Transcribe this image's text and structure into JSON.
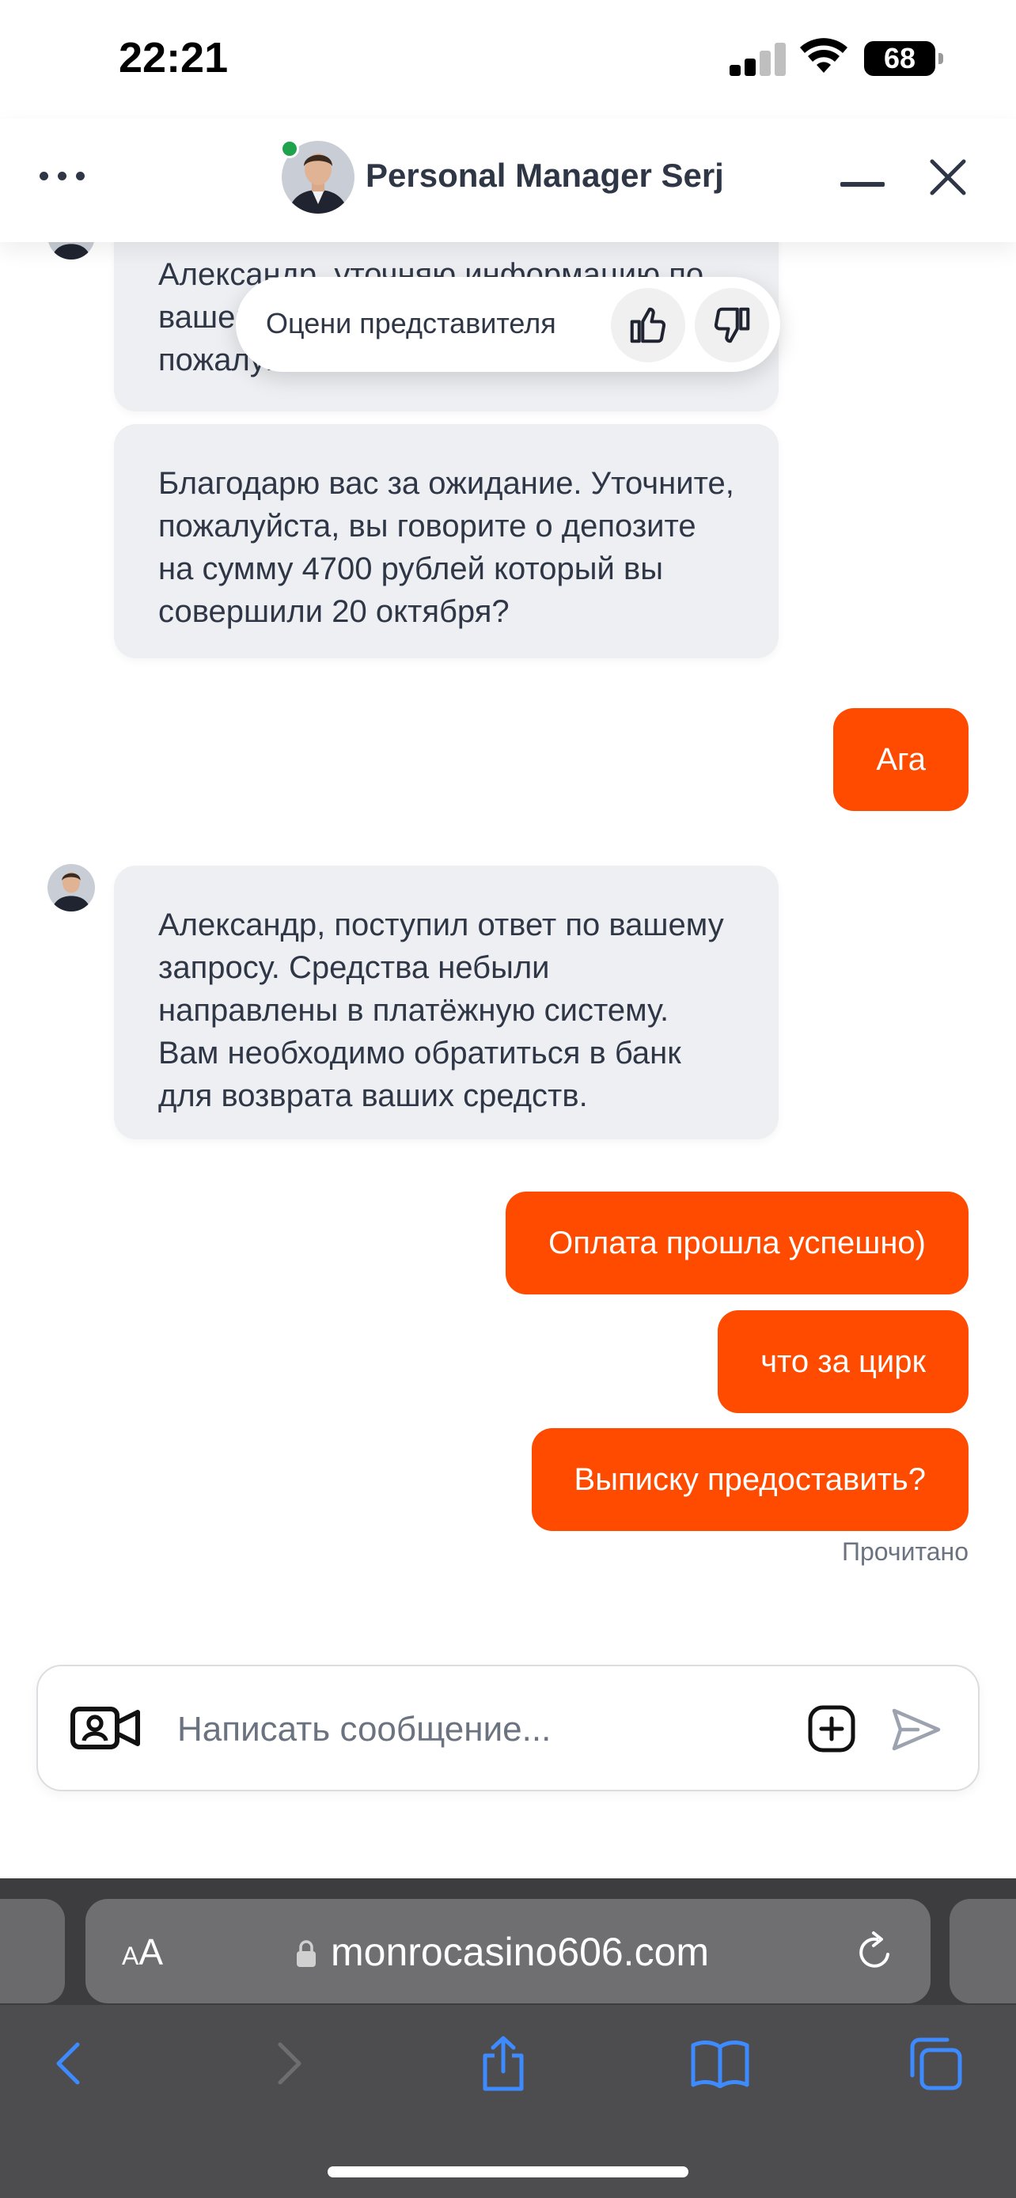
{
  "status_bar": {
    "time": "22:21",
    "battery": "68"
  },
  "header": {
    "title": "Personal Manager Serj"
  },
  "rating": {
    "label": "Оцени представителя"
  },
  "messages": {
    "m1": "Александр, уточняю информацию по вашему запросу, ожидайте пожалуйста.",
    "m2": "Благодарю вас за ожидание. Уточните, пожалуйста, вы говорите о депозите на сумму 4700 рублей который вы совершили 20 октября?",
    "u1": "Ага",
    "m3": "Александр, поступил ответ по вашему запросу. Средства небыли направлены в платёжную систему. Вам необходимо обратиться в банк для возврата ваших средств.",
    "u2": "Оплата прошла успешно)",
    "u3": "что за цирк",
    "u4": "Выписку предоставить?"
  },
  "read_status": "Прочитано",
  "composer": {
    "placeholder": "Написать сообщение..."
  },
  "browser": {
    "aa_label_small": "A",
    "aa_label_big": "A",
    "url": "monrocasino606.com"
  },
  "colors": {
    "accent": "#ff4b00",
    "agent_bubble": "#eeeff2",
    "online": "#1fa24c"
  }
}
